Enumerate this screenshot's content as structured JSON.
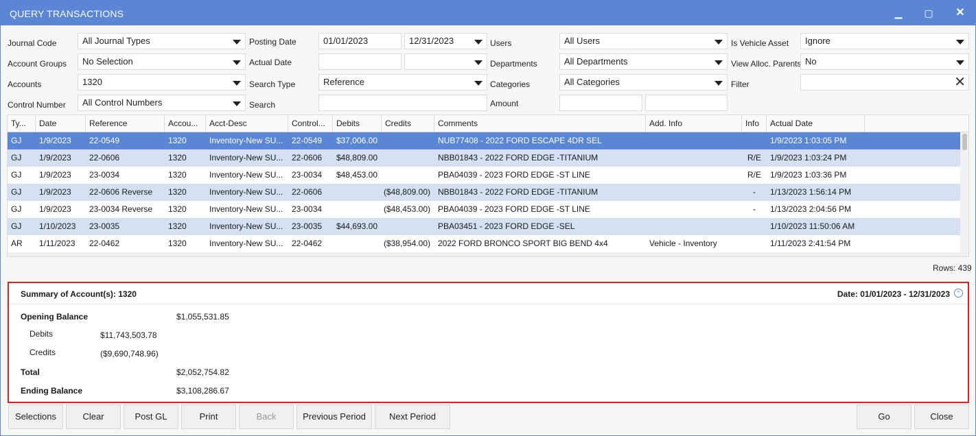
{
  "window": {
    "title": "QUERY TRANSACTIONS",
    "minimize": "▁",
    "maximize": "▢",
    "close": "✕"
  },
  "filters": {
    "journal_code": {
      "label": "Journal Code",
      "value": "All Journal Types"
    },
    "account_groups": {
      "label": "Account Groups",
      "value": "No Selection"
    },
    "accounts": {
      "label": "Accounts",
      "value": "1320"
    },
    "control_number": {
      "label": "Control Number",
      "value": "All Control Numbers"
    },
    "posting_date": {
      "label": "Posting Date",
      "from": "01/01/2023",
      "to": "12/31/2023"
    },
    "actual_date": {
      "label": "Actual Date",
      "from": "",
      "to": ""
    },
    "search_type": {
      "label": "Search Type",
      "value": "Reference"
    },
    "search": {
      "label": "Search",
      "value": ""
    },
    "users": {
      "label": "Users",
      "value": "All Users"
    },
    "departments": {
      "label": "Departments",
      "value": "All Departments"
    },
    "categories": {
      "label": "Categories",
      "value": "All Categories"
    },
    "amount": {
      "label": "Amount",
      "from": "",
      "to": ""
    },
    "is_vehicle_asset": {
      "label": "Is Vehicle Asset",
      "value": "Ignore"
    },
    "view_alloc_parents": {
      "label": "View Alloc. Parents",
      "value": "No"
    },
    "filter": {
      "label": "Filter",
      "value": ""
    }
  },
  "grid": {
    "columns": [
      "Ty...",
      "Date",
      "Reference",
      "Accou...",
      "Acct-Desc",
      "Control...",
      "Debits",
      "Credits",
      "Comments",
      "Add. Info",
      "Info",
      "Actual Date"
    ],
    "rows": [
      [
        "GJ",
        "1/9/2023",
        "22-0549",
        "1320",
        "Inventory-New SU...",
        "22-0549",
        "$37,006.00",
        "",
        "NUB77408 - 2022 FORD ESCAPE 4DR SEL",
        "",
        "",
        "1/9/2023 1:03:05 PM"
      ],
      [
        "GJ",
        "1/9/2023",
        "22-0606",
        "1320",
        "Inventory-New SU...",
        "22-0606",
        "$48,809.00",
        "",
        "NBB01843 - 2022 FORD EDGE -TITANIUM",
        "",
        "R/E",
        "1/9/2023 1:03:24 PM"
      ],
      [
        "GJ",
        "1/9/2023",
        "23-0034",
        "1320",
        "Inventory-New SU...",
        "23-0034",
        "$48,453.00",
        "",
        "PBA04039 - 2023 FORD EDGE -ST LINE",
        "",
        "R/E",
        "1/9/2023 1:03:36 PM"
      ],
      [
        "GJ",
        "1/9/2023",
        "22-0606 Reverse",
        "1320",
        "Inventory-New SU...",
        "22-0606",
        "",
        "($48,809.00)",
        "NBB01843 - 2022 FORD EDGE -TITANIUM",
        "",
        "-",
        "1/13/2023 1:56:14 PM"
      ],
      [
        "GJ",
        "1/9/2023",
        "23-0034 Reverse",
        "1320",
        "Inventory-New SU...",
        "23-0034",
        "",
        "($48,453.00)",
        "PBA04039 - 2023 FORD EDGE -ST LINE",
        "",
        "-",
        "1/13/2023 2:04:56 PM"
      ],
      [
        "GJ",
        "1/10/2023",
        "23-0035",
        "1320",
        "Inventory-New SU...",
        "23-0035",
        "$44,693.00",
        "",
        "PBA03451 - 2023 FORD EDGE -SEL",
        "",
        "",
        "1/10/2023 11:50:06 AM"
      ],
      [
        "AR",
        "1/11/2023",
        "22-0462",
        "1320",
        "Inventory-New SU...",
        "22-0462",
        "",
        "($38,954.00)",
        "2022 FORD BRONCO SPORT BIG BEND 4x4",
        "Vehicle - Inventory",
        "",
        "1/11/2023 2:41:54 PM"
      ]
    ],
    "row_count": "Rows: 439"
  },
  "summary": {
    "title": "Summary of Account(s): 1320",
    "date_range": "Date: 01/01/2023 - 12/31/2023",
    "collapse_glyph": "^",
    "opening_label": "Opening Balance",
    "opening_value": "$1,055,531.85",
    "debits_label": "Debits",
    "debits_value": "$11,743,503.78",
    "credits_label": "Credits",
    "credits_value": "($9,690,748.96)",
    "total_label": "Total",
    "total_value": "$2,052,754.82",
    "ending_label": "Ending Balance",
    "ending_value": "$3,108,286.67"
  },
  "buttons": {
    "selections": "Selections",
    "clear": "Clear",
    "post_gl": "Post GL",
    "print": "Print",
    "back": "Back",
    "previous_period": "Previous Period",
    "next_period": "Next Period",
    "go": "Go",
    "close": "Close"
  },
  "colors": {
    "accent": "#5b86d6",
    "row_alt": "#d5e1f3",
    "highlight_border": "#e01e1e"
  }
}
